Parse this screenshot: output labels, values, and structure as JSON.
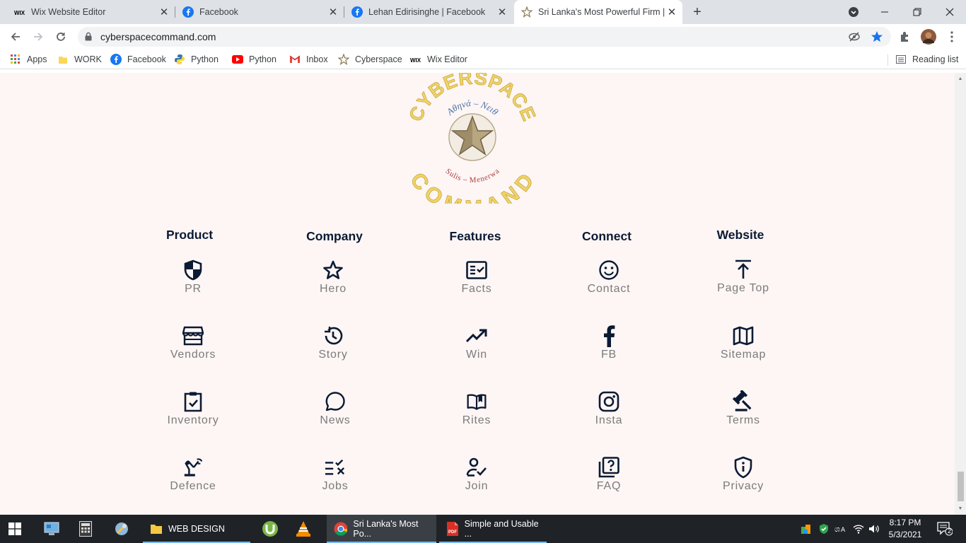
{
  "browser": {
    "tabs": [
      {
        "title": "Wix Website Editor",
        "icon": "wix-icon"
      },
      {
        "title": "Facebook",
        "icon": "facebook-icon"
      },
      {
        "title": "Lehan Edirisinghe | Facebook",
        "icon": "facebook-icon"
      },
      {
        "title": "Sri Lanka's Most Powerful Firm | I",
        "icon": "cyberspace-star-icon",
        "active": true
      }
    ],
    "url": "cyberspacecommand.com",
    "bookmarks": [
      {
        "label": "Apps",
        "icon": "apps-grid-icon"
      },
      {
        "label": "WORK",
        "icon": "folder-icon"
      },
      {
        "label": "Facebook",
        "icon": "facebook-icon"
      },
      {
        "label": "Python",
        "icon": "python-icon"
      },
      {
        "label": "Python",
        "icon": "youtube-icon"
      },
      {
        "label": "Inbox",
        "icon": "gmail-icon"
      },
      {
        "label": "Cyberspace",
        "icon": "cyberspace-star-icon"
      },
      {
        "label": "Wix Editor",
        "icon": "wix-icon"
      }
    ],
    "reading_list": "Reading list"
  },
  "logo": {
    "top_text": "CYBERSPACE",
    "bottom_text": "COMMAND",
    "inner_top": "Αθηνά – Νειθ",
    "inner_bottom": "Sulis – Menerwa"
  },
  "footer": {
    "columns": [
      {
        "heading": "Product",
        "items": [
          {
            "label": "PR",
            "icon": "shield-icon"
          },
          {
            "label": "Vendors",
            "icon": "storefront-icon"
          },
          {
            "label": "Inventory",
            "icon": "clipboard-check-icon"
          },
          {
            "label": "Defence",
            "icon": "robot-arm-icon"
          }
        ]
      },
      {
        "heading": "Company",
        "items": [
          {
            "label": "Hero",
            "icon": "star-icon"
          },
          {
            "label": "Story",
            "icon": "history-icon"
          },
          {
            "label": "News",
            "icon": "chat-bubble-icon"
          },
          {
            "label": "Jobs",
            "icon": "checklist-icon"
          }
        ]
      },
      {
        "heading": "Features",
        "items": [
          {
            "label": "Facts",
            "icon": "fact-check-icon"
          },
          {
            "label": "Win",
            "icon": "trending-up-icon"
          },
          {
            "label": "Rites",
            "icon": "open-book-icon"
          },
          {
            "label": "Join",
            "icon": "person-check-icon"
          }
        ]
      },
      {
        "heading": "Connect",
        "items": [
          {
            "label": "Contact",
            "icon": "smiley-icon"
          },
          {
            "label": "FB",
            "icon": "facebook-f-icon"
          },
          {
            "label": "Insta",
            "icon": "instagram-icon"
          },
          {
            "label": "FAQ",
            "icon": "question-box-icon"
          }
        ]
      },
      {
        "heading": "Website",
        "items": [
          {
            "label": "Page Top",
            "icon": "arrow-to-top-icon"
          },
          {
            "label": "Sitemap",
            "icon": "map-icon"
          },
          {
            "label": "Terms",
            "icon": "gavel-icon"
          },
          {
            "label": "Privacy",
            "icon": "privacy-shield-icon"
          }
        ]
      }
    ]
  },
  "taskbar": {
    "apps": [
      {
        "label": "WEB DESIGN",
        "icon": "folder-icon"
      },
      {
        "label": "Sri Lanka's Most Po...",
        "icon": "chrome-icon"
      },
      {
        "label": "Simple and Usable ...",
        "icon": "pdf-icon"
      }
    ],
    "time": "8:17 PM",
    "date": "5/3/2021",
    "notifications": "2"
  },
  "colors": {
    "page_bg": "#fdf6f5",
    "heading": "#0b1a33",
    "icon": "#0b1a33",
    "label": "#7b7b7b",
    "logo_gold": "#e8c547",
    "taskbar": "#1f2328"
  }
}
